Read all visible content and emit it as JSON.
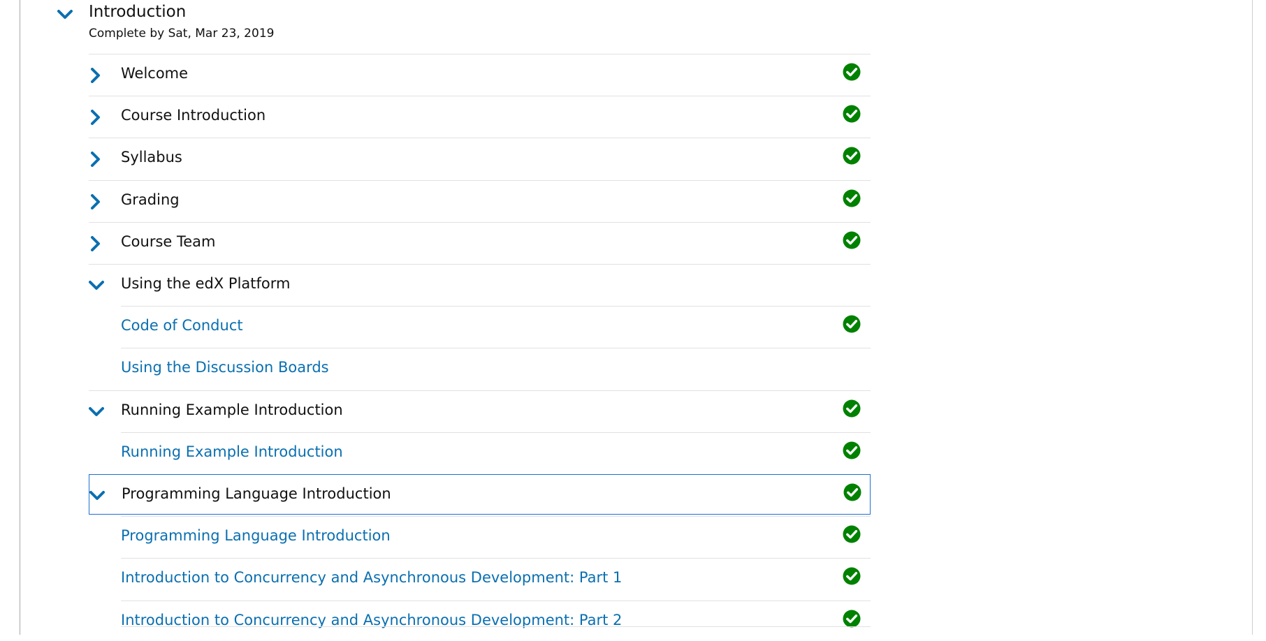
{
  "section": {
    "title": "Introduction",
    "due": "Complete by Sat, Mar 23, 2019",
    "expanded": true
  },
  "colors": {
    "accent": "#0a6fb0",
    "complete": "#008100",
    "focus": "#1f6fd1"
  },
  "icons": {
    "collapsed": "chevron-right-icon",
    "expanded": "chevron-down-icon",
    "complete": "check-circle-icon"
  },
  "items": [
    {
      "type": "subsection",
      "label": "Welcome",
      "expanded": false,
      "complete": true
    },
    {
      "type": "subsection",
      "label": "Course Introduction",
      "expanded": false,
      "complete": true
    },
    {
      "type": "subsection",
      "label": "Syllabus",
      "expanded": false,
      "complete": true
    },
    {
      "type": "subsection",
      "label": "Grading",
      "expanded": false,
      "complete": true
    },
    {
      "type": "subsection",
      "label": "Course Team",
      "expanded": false,
      "complete": true
    },
    {
      "type": "subsection",
      "label": "Using the edX Platform",
      "expanded": true,
      "complete": false
    },
    {
      "type": "unit",
      "label": "Code of Conduct",
      "complete": true
    },
    {
      "type": "unit",
      "label": "Using the Discussion Boards",
      "complete": false
    },
    {
      "type": "subsection",
      "label": "Running Example Introduction",
      "expanded": true,
      "complete": true
    },
    {
      "type": "unit",
      "label": "Running Example Introduction",
      "complete": true
    },
    {
      "type": "subsection",
      "label": "Programming Language Introduction",
      "expanded": true,
      "complete": true,
      "focused": true
    },
    {
      "type": "unit",
      "label": "Programming Language Introduction",
      "complete": true
    },
    {
      "type": "unit",
      "label": "Introduction to Concurrency and Asynchronous Development: Part 1",
      "complete": true
    },
    {
      "type": "unit",
      "label": "Introduction to Concurrency and Asynchronous Development: Part 2",
      "complete": true
    }
  ]
}
